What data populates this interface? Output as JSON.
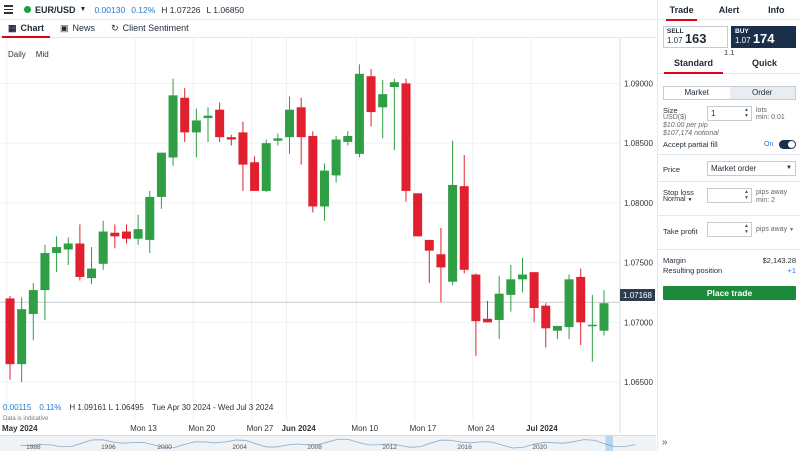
{
  "topbar": {
    "symbol": "EUR/USD",
    "change": "0.00130",
    "change_pct": "0.12%",
    "high": "H 1.07226",
    "low": "L 1.06850"
  },
  "tabs": [
    {
      "label": "Chart",
      "icon": "chart-icon"
    },
    {
      "label": "News",
      "icon": "news-icon"
    },
    {
      "label": "Client Sentiment",
      "icon": "sentiment-icon"
    }
  ],
  "chart": {
    "interval_daily": "Daily",
    "interval_mid": "Mid",
    "stats": {
      "change": "0.00115",
      "change_pct": "0.11%",
      "hl": "H 1.09161 L 1.06495",
      "range": "Tue Apr 30 2024 - Wed Jul 3 2024"
    },
    "disclaimer": "Data is indicative",
    "last_price": "1.07168",
    "nav_years": [
      "1988",
      "1996",
      "2000",
      "2004",
      "2008",
      "2012",
      "2016",
      "2020"
    ],
    "colors": {
      "up": "#2f9e44",
      "down": "#e0202e",
      "grid": "#eef1f4"
    }
  },
  "chart_data": {
    "type": "candlestick",
    "instrument": "EUR/USD",
    "interval": "Daily",
    "y_ticks": [
      "1.09000",
      "1.08500",
      "1.08000",
      "1.07500",
      "1.07000",
      "1.06500"
    ],
    "ylim": [
      1.0635,
      1.0938
    ],
    "x_ticks": [
      {
        "label": "May 2024",
        "index": 0,
        "bold": true
      },
      {
        "label": "Mon 13",
        "index": 11
      },
      {
        "label": "Mon 20",
        "index": 16
      },
      {
        "label": "Mon 27",
        "index": 21
      },
      {
        "label": "Jun 2024",
        "index": 24,
        "bold": true
      },
      {
        "label": "Mon 10",
        "index": 30
      },
      {
        "label": "Mon 17",
        "index": 35
      },
      {
        "label": "Mon 24",
        "index": 40
      },
      {
        "label": "Jul 2024",
        "index": 45,
        "bold": true
      }
    ],
    "candles": [
      {
        "o": 1.072,
        "h": 1.0722,
        "l": 1.0652,
        "c": 1.0665
      },
      {
        "o": 1.0665,
        "h": 1.0721,
        "l": 1.065,
        "c": 1.0711
      },
      {
        "o": 1.0707,
        "h": 1.0733,
        "l": 1.0685,
        "c": 1.0727
      },
      {
        "o": 1.0727,
        "h": 1.0765,
        "l": 1.0702,
        "c": 1.0758
      },
      {
        "o": 1.0758,
        "h": 1.0772,
        "l": 1.0742,
        "c": 1.0763
      },
      {
        "o": 1.0761,
        "h": 1.0771,
        "l": 1.0748,
        "c": 1.0766
      },
      {
        "o": 1.0766,
        "h": 1.0782,
        "l": 1.0735,
        "c": 1.0738
      },
      {
        "o": 1.0737,
        "h": 1.0763,
        "l": 1.0732,
        "c": 1.0745
      },
      {
        "o": 1.0749,
        "h": 1.0785,
        "l": 1.0744,
        "c": 1.0776
      },
      {
        "o": 1.0775,
        "h": 1.0782,
        "l": 1.0762,
        "c": 1.0772
      },
      {
        "o": 1.0776,
        "h": 1.0782,
        "l": 1.0766,
        "c": 1.077
      },
      {
        "o": 1.077,
        "h": 1.079,
        "l": 1.0765,
        "c": 1.0778
      },
      {
        "o": 1.0769,
        "h": 1.081,
        "l": 1.0758,
        "c": 1.0805
      },
      {
        "o": 1.0805,
        "h": 1.0832,
        "l": 1.0795,
        "c": 1.0842
      },
      {
        "o": 1.0838,
        "h": 1.0904,
        "l": 1.0831,
        "c": 1.089
      },
      {
        "o": 1.0888,
        "h": 1.0896,
        "l": 1.0851,
        "c": 1.0859
      },
      {
        "o": 1.0859,
        "h": 1.0879,
        "l": 1.0838,
        "c": 1.0869
      },
      {
        "o": 1.0871,
        "h": 1.088,
        "l": 1.0851,
        "c": 1.0873
      },
      {
        "o": 1.0878,
        "h": 1.0884,
        "l": 1.0851,
        "c": 1.0855
      },
      {
        "o": 1.0855,
        "h": 1.0857,
        "l": 1.0848,
        "c": 1.0853
      },
      {
        "o": 1.0859,
        "h": 1.0868,
        "l": 1.081,
        "c": 1.0832
      },
      {
        "o": 1.0834,
        "h": 1.0839,
        "l": 1.0811,
        "c": 1.081
      },
      {
        "o": 1.081,
        "h": 1.0853,
        "l": 1.0809,
        "c": 1.085
      },
      {
        "o": 1.0852,
        "h": 1.0858,
        "l": 1.0848,
        "c": 1.0854
      },
      {
        "o": 1.0855,
        "h": 1.0889,
        "l": 1.0841,
        "c": 1.0878
      },
      {
        "o": 1.088,
        "h": 1.0888,
        "l": 1.0832,
        "c": 1.0855
      },
      {
        "o": 1.0856,
        "h": 1.086,
        "l": 1.0792,
        "c": 1.0797
      },
      {
        "o": 1.0797,
        "h": 1.0833,
        "l": 1.0785,
        "c": 1.0827
      },
      {
        "o": 1.0823,
        "h": 1.0856,
        "l": 1.0817,
        "c": 1.0853
      },
      {
        "o": 1.0851,
        "h": 1.086,
        "l": 1.0848,
        "c": 1.0856
      },
      {
        "o": 1.0841,
        "h": 1.0916,
        "l": 1.0838,
        "c": 1.0908
      },
      {
        "o": 1.0906,
        "h": 1.0912,
        "l": 1.0864,
        "c": 1.0876
      },
      {
        "o": 1.088,
        "h": 1.0903,
        "l": 1.0854,
        "c": 1.0891
      },
      {
        "o": 1.0897,
        "h": 1.0904,
        "l": 1.0844,
        "c": 1.0901
      },
      {
        "o": 1.09,
        "h": 1.0904,
        "l": 1.0801,
        "c": 1.081
      },
      {
        "o": 1.0808,
        "h": 1.0793,
        "l": 1.0782,
        "c": 1.0772
      },
      {
        "o": 1.0769,
        "h": 1.076,
        "l": 1.0733,
        "c": 1.076
      },
      {
        "o": 1.0757,
        "h": 1.0779,
        "l": 1.0717,
        "c": 1.0746
      },
      {
        "o": 1.0734,
        "h": 1.0852,
        "l": 1.0731,
        "c": 1.0815
      },
      {
        "o": 1.0814,
        "h": 1.084,
        "l": 1.0741,
        "c": 1.0744
      },
      {
        "o": 1.074,
        "h": 1.0741,
        "l": 1.0672,
        "c": 1.0701
      },
      {
        "o": 1.0703,
        "h": 1.0718,
        "l": 1.07,
        "c": 1.07
      },
      {
        "o": 1.0702,
        "h": 1.0739,
        "l": 1.0686,
        "c": 1.0724
      },
      {
        "o": 1.0723,
        "h": 1.0748,
        "l": 1.0709,
        "c": 1.0736
      },
      {
        "o": 1.0736,
        "h": 1.0754,
        "l": 1.0725,
        "c": 1.074
      },
      {
        "o": 1.0742,
        "h": 1.0742,
        "l": 1.07,
        "c": 1.0712
      },
      {
        "o": 1.0714,
        "h": 1.0716,
        "l": 1.0679,
        "c": 1.0695
      },
      {
        "o": 1.0693,
        "h": 1.0695,
        "l": 1.0686,
        "c": 1.0697
      },
      {
        "o": 1.0696,
        "h": 1.074,
        "l": 1.0686,
        "c": 1.0736
      },
      {
        "o": 1.0738,
        "h": 1.0745,
        "l": 1.0681,
        "c": 1.07
      },
      {
        "o": 1.0697,
        "h": 1.0723,
        "l": 1.0667,
        "c": 1.0698
      },
      {
        "o": 1.0693,
        "h": 1.0727,
        "l": 1.0689,
        "c": 1.0716
      }
    ]
  },
  "panel": {
    "tabs": [
      "Trade",
      "Alert",
      "Info"
    ],
    "sell_label": "SELL",
    "sell_prefix": "1.07",
    "sell_big": "163",
    "buy_label": "BUY",
    "buy_prefix": "1.07",
    "buy_big": "174",
    "spread": "1.1",
    "mode_tabs": [
      "Standard",
      "Quick"
    ],
    "order_types": [
      "Market",
      "Order"
    ],
    "size_label": "Size",
    "size_unit": "USD($)",
    "size_value": "1",
    "lots_label": "lots",
    "lots_min": "min: 0.01",
    "per_pip": "$10.00 per pip",
    "notional": "$107,174 notional",
    "partial_fill_label": "Accept partial fill",
    "partial_fill_state": "On",
    "price_label": "Price",
    "price_value": "Market order",
    "stop_label": "Stop loss",
    "stop_type": "Normal",
    "stop_unit": "pips away",
    "stop_min": "min: 2",
    "take_label": "Take profit",
    "take_unit": "pips away",
    "margin_label": "Margin",
    "margin_value": "$2,143.28",
    "position_label": "Resulting position",
    "position_value": "+1",
    "place_trade": "Place trade"
  }
}
